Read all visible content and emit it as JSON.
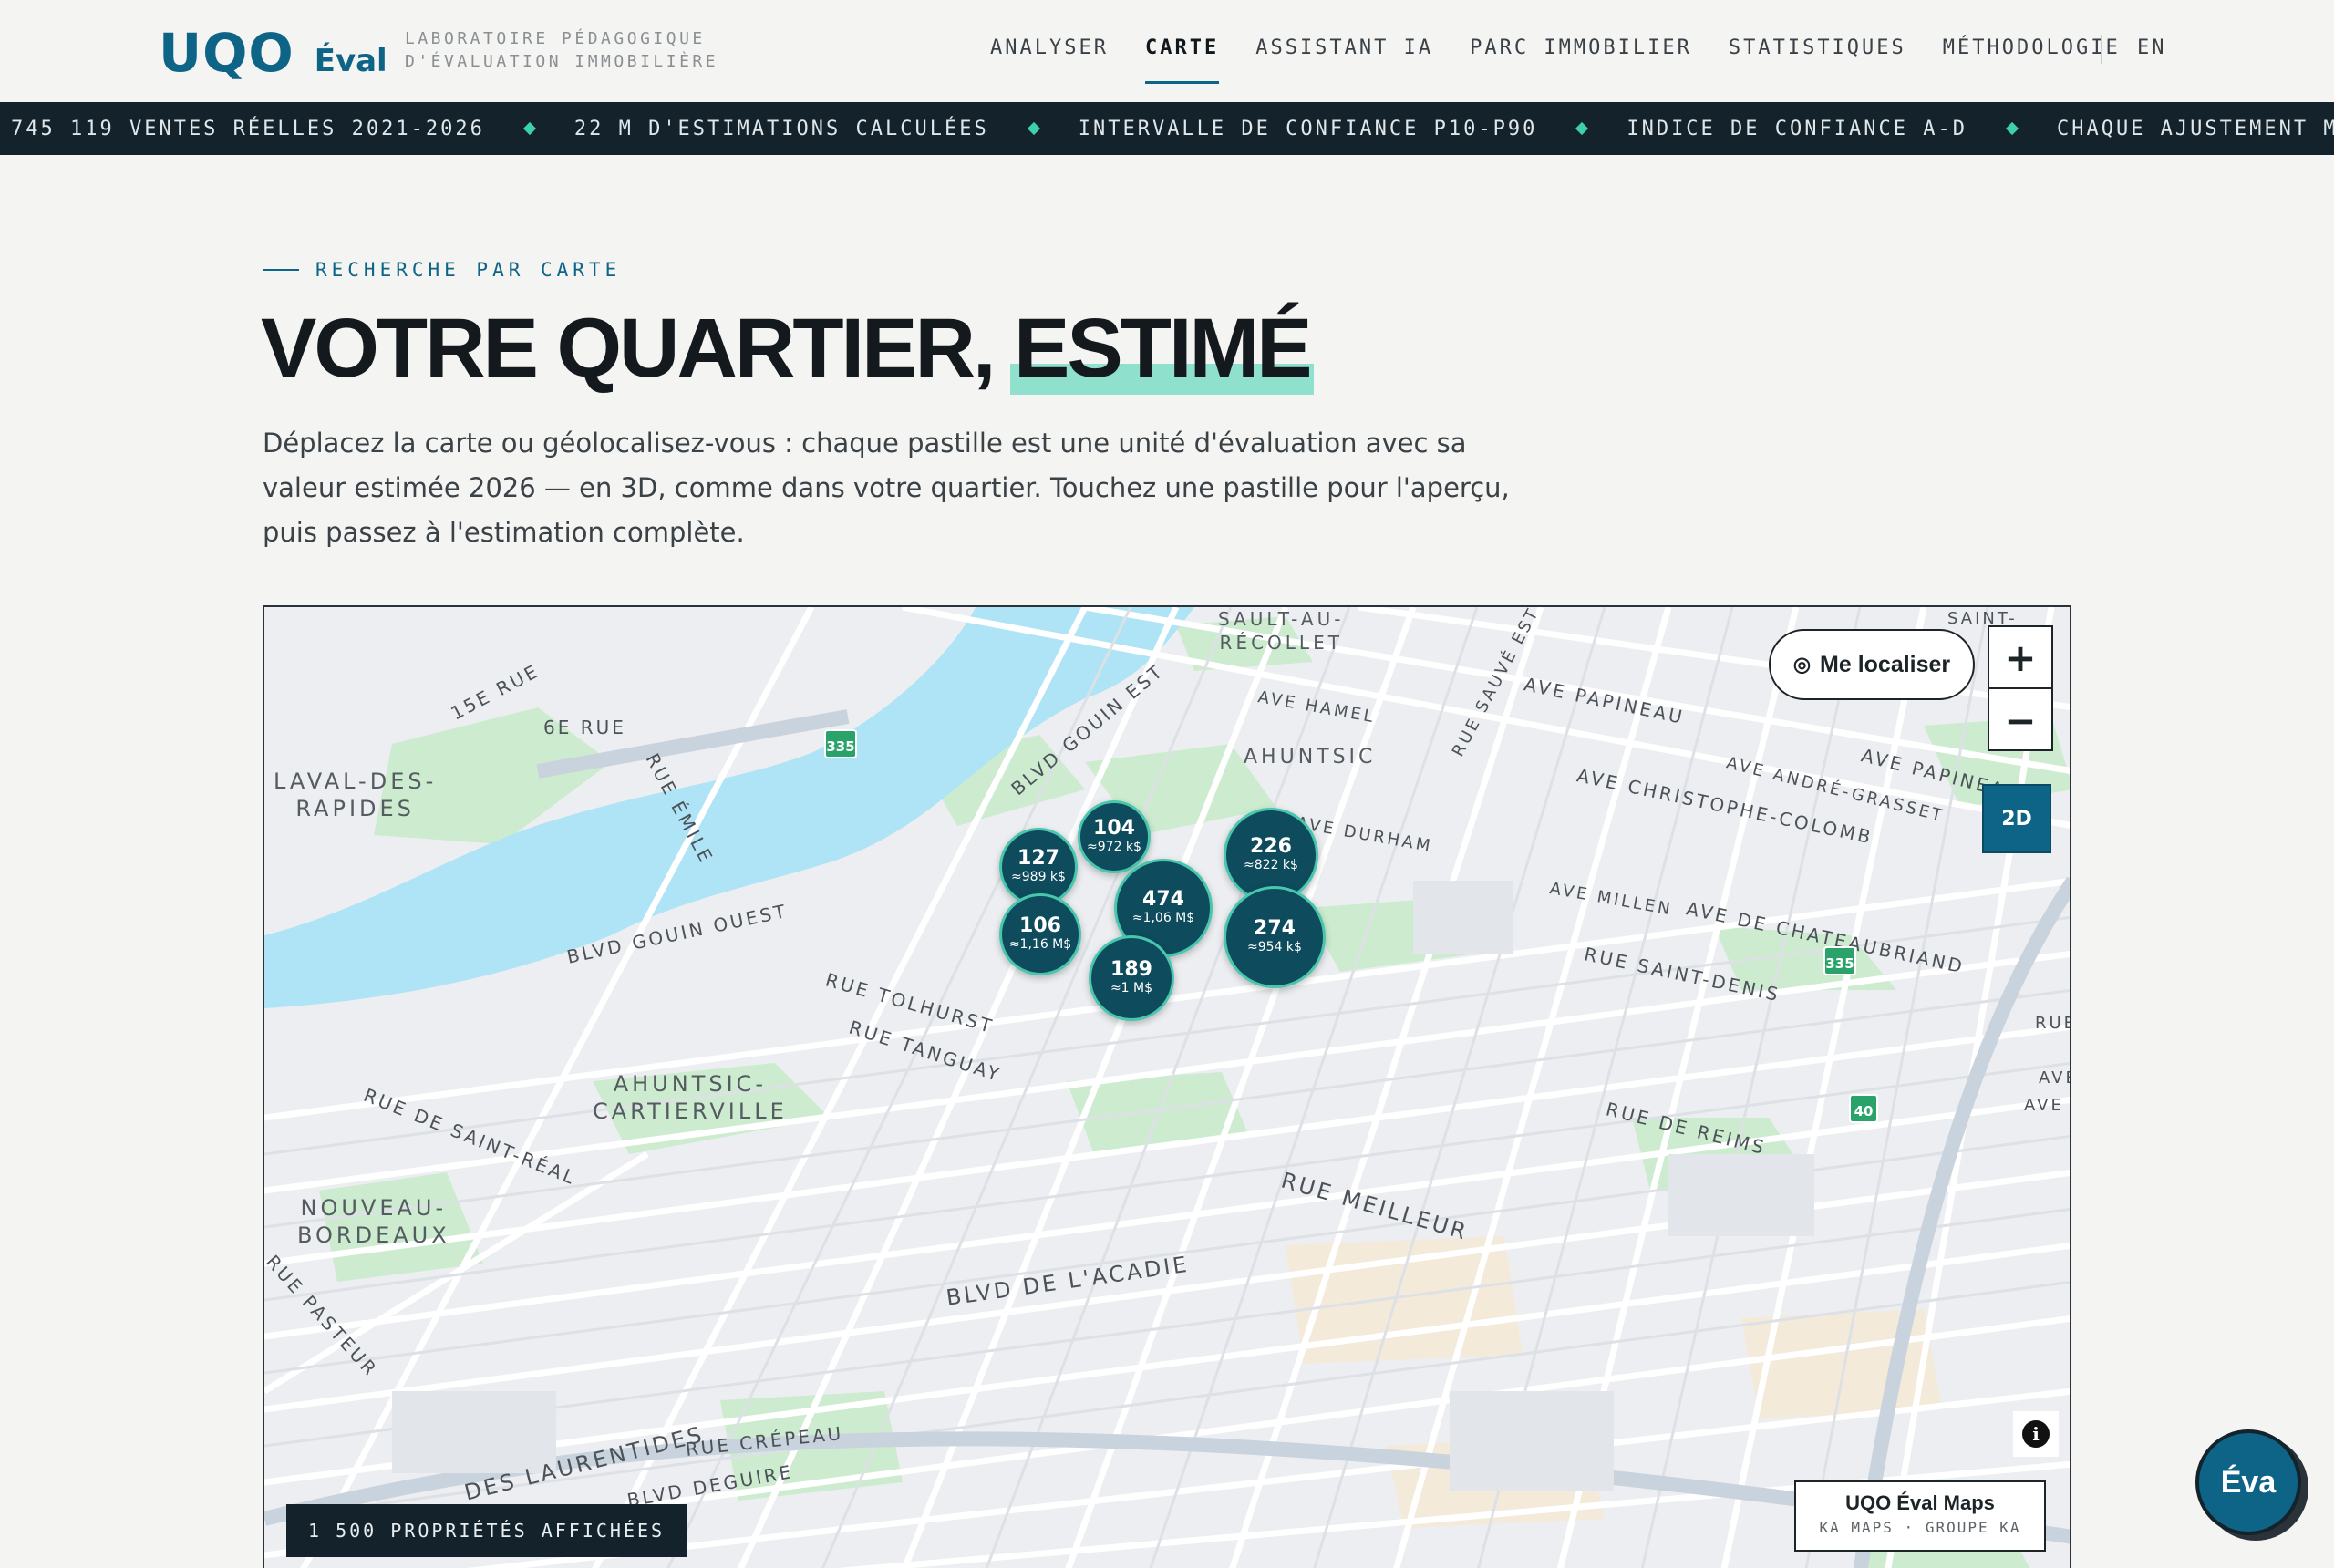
{
  "header": {
    "logo_main": "UQO",
    "logo_sub": "Éval",
    "tagline_line1": "LABORATOIRE PÉDAGOGIQUE",
    "tagline_line2": "D'ÉVALUATION IMMOBILIÈRE",
    "nav": [
      {
        "label": "ANALYSER",
        "active": false
      },
      {
        "label": "CARTE",
        "active": true
      },
      {
        "label": "ASSISTANT IA",
        "active": false
      },
      {
        "label": "PARC IMMOBILIER",
        "active": false
      },
      {
        "label": "STATISTIQUES",
        "active": false
      },
      {
        "label": "MÉTHODOLOGIE",
        "active": false
      }
    ],
    "lang": "EN"
  },
  "ticker": [
    "745 119 VENTES RÉELLES 2021-2026",
    "22 M D'ESTIMATIONS CALCULÉES",
    "INTERVALLE DE CONFIANCE P10-P90",
    "INDICE DE CONFIANCE A-D",
    "CHAQUE AJUSTEMENT MONTRÉ EN DOLLARS"
  ],
  "intro": {
    "eyebrow": "RECHERCHE PAR CARTE",
    "title_main": "VOTRE QUARTIER, ",
    "title_highlight": "ESTIMÉ",
    "lede": "Déplacez la carte ou géolocalisez-vous : chaque pastille est une unité d'évaluation avec sa valeur estimée 2026 — en 3D, comme dans votre quartier. Touchez une pastille pour l'aperçu, puis passez à l'estimation complète."
  },
  "map": {
    "locate_label": "Me localiser",
    "zoom_in": "+",
    "zoom_out": "−",
    "view_mode": "2D",
    "attribution_title": "UQO Éval Maps",
    "attribution_sub": "KA MAPS · GROUPE KA",
    "properties_count": "1 500 PROPRIÉTÉS AFFICHÉES",
    "districts": [
      "LAVAL-DES-\nRAPIDES",
      "AHUNTSIC-\nCARTIERVILLE",
      "NOUVEAU-\nBORDEAUX",
      "AHUNTSIC",
      "SAULT-AU-\nRÉCOLLET"
    ],
    "streets": [
      "15E RUE",
      "6E RUE",
      "RUE ÉMILE",
      "BLVD GOUIN EST",
      "AVE HAMEL",
      "RUE SAUVÉ EST",
      "AVE PAPINEAU",
      "AVE CHRISTOPHE-COLOMB",
      "AVE ANDRÉ-GRASSET",
      "AVE PAPINEAU",
      "AVE DURHAM",
      "AVE MILLEN",
      "AVE DE CHATEAUBRIAND",
      "RUE SAINT-DENIS",
      "BLVD GOUIN OUEST",
      "RUE TOLHURST",
      "RUE TANGUAY",
      "RUE DE SAINT-RÉAL",
      "RUE DE REIMS",
      "RUE MEILLEUR",
      "BLVD DE L'ACADIE",
      "RUE PASTEUR",
      "DES LAURENTIDES",
      "RUE CRÉPEAU",
      "BLVD DEGUIRE",
      "SAINT-",
      "RUE",
      "AVE",
      "AVE"
    ],
    "highways": [
      "335",
      "335",
      "40"
    ],
    "clusters": [
      {
        "count": "104",
        "value": "≈972 k$"
      },
      {
        "count": "127",
        "value": "≈989 k$"
      },
      {
        "count": "474",
        "value": "≈1,06 M$"
      },
      {
        "count": "226",
        "value": "≈822 k$"
      },
      {
        "count": "106",
        "value": "≈1,16 M$"
      },
      {
        "count": "274",
        "value": "≈954 k$"
      },
      {
        "count": "189",
        "value": "≈1 M$"
      }
    ]
  },
  "assistant": {
    "label": "Éva"
  },
  "colors": {
    "brand": "#0d6486",
    "accent": "#3ecfb0",
    "dark": "#13222b",
    "water": "#aee4f5",
    "park": "#cdeccf"
  }
}
